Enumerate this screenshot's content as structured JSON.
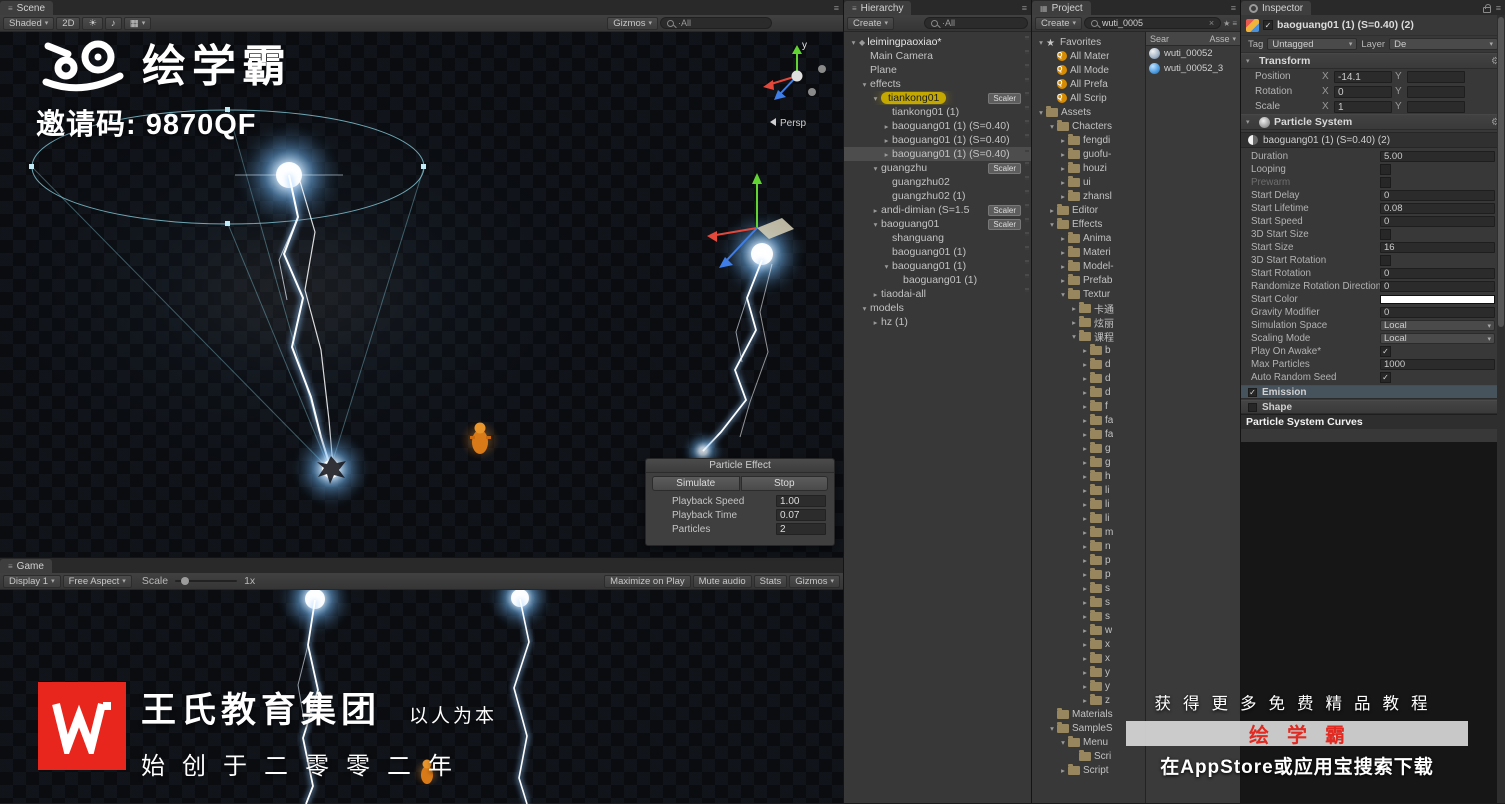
{
  "icons": {
    "caret": "▾",
    "collapsed": "▸",
    "menu": "≡",
    "grid": "▦",
    "sun": "☀",
    "audio": "♪",
    "gear": "⚙",
    "clear": "×",
    "star": "★",
    "check": "✓"
  },
  "colors": {
    "brand_red": "#e02a22",
    "ping_yellow": "#c2a800",
    "lightning_glow": "#7ec8ff",
    "selection_gray": "#4d4d4d",
    "panel_bg": "#383838"
  },
  "scene": {
    "tab": "Scene",
    "toolbar": {
      "shaded": "Shaded",
      "mode_2d": "2D",
      "gizmos": "Gizmos",
      "search": "·All"
    },
    "axis_y": "y",
    "persp": "Persp",
    "particle_effect": {
      "title": "Particle Effect",
      "simulate": "Simulate",
      "stop": "Stop",
      "rows": [
        {
          "label": "Playback Speed",
          "value": "1.00"
        },
        {
          "label": "Playback Time",
          "value": "0.07"
        },
        {
          "label": "Particles",
          "value": "2"
        }
      ]
    }
  },
  "game": {
    "tab": "Game",
    "toolbar": {
      "display": "Display 1",
      "aspect": "Free Aspect",
      "scale_label": "Scale",
      "scale_value": "1x",
      "maximize": "Maximize on Play",
      "mute": "Mute audio",
      "stats": "Stats",
      "gizmos": "Gizmos"
    }
  },
  "hierarchy": {
    "tab": "Hierarchy",
    "create": "Create",
    "search": "·All",
    "items": [
      {
        "label": "leimingpaoxiao*",
        "arrow": "▾",
        "indent": 0,
        "cls": "scene-root"
      },
      {
        "label": "Main Camera",
        "indent": 1
      },
      {
        "label": "Plane",
        "indent": 1
      },
      {
        "label": "effects",
        "arrow": "▾",
        "indent": 1
      },
      {
        "label": "tiankong01",
        "arrow": "▾",
        "indent": 2,
        "badge": "Scaler",
        "cls": "ping"
      },
      {
        "label": "tiankong01 (1)",
        "indent": 3
      },
      {
        "label": "baoguang01 (1) (S=0.40)",
        "arrow": "▸",
        "indent": 3
      },
      {
        "label": "baoguang01 (1) (S=0.40)",
        "arrow": "▸",
        "indent": 3
      },
      {
        "label": "baoguang01 (1) (S=0.40)",
        "arrow": "▸",
        "indent": 3,
        "cls": "selected"
      },
      {
        "label": "guangzhu",
        "arrow": "▾",
        "indent": 2,
        "badge": "Scaler"
      },
      {
        "label": "guangzhu02",
        "indent": 3
      },
      {
        "label": "guangzhu02 (1)",
        "indent": 3
      },
      {
        "label": "andi-dimian (S=1.5",
        "arrow": "▸",
        "indent": 2,
        "badge": "Scaler"
      },
      {
        "label": "baoguang01",
        "arrow": "▾",
        "indent": 2,
        "badge": "Scaler"
      },
      {
        "label": "shanguang",
        "indent": 3
      },
      {
        "label": "baoguang01 (1)",
        "indent": 3
      },
      {
        "label": "baoguang01 (1)",
        "arrow": "▾",
        "indent": 3
      },
      {
        "label": "baoguang01 (1)",
        "indent": 4
      },
      {
        "label": "tiaodai-all",
        "arrow": "▸",
        "indent": 2
      },
      {
        "label": "models",
        "arrow": "▾",
        "indent": 1
      },
      {
        "label": "hz (1)",
        "arrow": "▸",
        "indent": 2
      }
    ]
  },
  "project": {
    "tab": "Project",
    "create": "Create",
    "search_value": "wuti_0005",
    "results_header_left": "Sear",
    "results_header_right": "Asse",
    "results": [
      {
        "label": "wuti_00052",
        "icon": "mesh"
      },
      {
        "label": "wuti_00052_3",
        "icon": "prefab"
      }
    ],
    "tree": [
      {
        "label": "Favorites",
        "arrow": "▾",
        "icon": "star",
        "indent": 0
      },
      {
        "label": "All Mater",
        "icon": "q",
        "indent": 1
      },
      {
        "label": "All Mode",
        "icon": "q",
        "indent": 1
      },
      {
        "label": "All Prefa",
        "icon": "q",
        "indent": 1
      },
      {
        "label": "All Scrip",
        "icon": "q",
        "indent": 1
      },
      {
        "label": "Assets",
        "arrow": "▾",
        "icon": "folder",
        "indent": 0
      },
      {
        "label": "Chacters",
        "arrow": "▾",
        "icon": "folder",
        "indent": 1
      },
      {
        "label": "fengdi",
        "arrow": "▸",
        "icon": "folder",
        "indent": 2
      },
      {
        "label": "guofu-",
        "arrow": "▸",
        "icon": "folder",
        "indent": 2
      },
      {
        "label": "houzi",
        "arrow": "▸",
        "icon": "folder",
        "indent": 2
      },
      {
        "label": "ui",
        "arrow": "▸",
        "icon": "folder",
        "indent": 2
      },
      {
        "label": "zhansl",
        "arrow": "▸",
        "icon": "folder",
        "indent": 2
      },
      {
        "label": "Editor",
        "arrow": "▸",
        "icon": "folder",
        "indent": 1
      },
      {
        "label": "Effects",
        "arrow": "▾",
        "icon": "folder",
        "indent": 1
      },
      {
        "label": "Anima",
        "arrow": "▸",
        "icon": "folder",
        "indent": 2
      },
      {
        "label": "Materi",
        "arrow": "▸",
        "icon": "folder",
        "indent": 2
      },
      {
        "label": "Model-",
        "arrow": "▸",
        "icon": "folder",
        "indent": 2
      },
      {
        "label": "Prefab",
        "arrow": "▸",
        "icon": "folder",
        "indent": 2
      },
      {
        "label": "Textur",
        "arrow": "▾",
        "icon": "folder",
        "indent": 2
      },
      {
        "label": "卡通",
        "arrow": "▸",
        "icon": "folder",
        "indent": 3
      },
      {
        "label": "炫丽",
        "arrow": "▸",
        "icon": "folder",
        "indent": 3
      },
      {
        "label": "课程",
        "arrow": "▾",
        "icon": "folder",
        "indent": 3
      },
      {
        "label": "b",
        "arrow": "▸",
        "icon": "folder",
        "indent": 4
      },
      {
        "label": "d",
        "arrow": "▸",
        "icon": "folder",
        "indent": 4
      },
      {
        "label": "d",
        "arrow": "▸",
        "icon": "folder",
        "indent": 4
      },
      {
        "label": "d",
        "arrow": "▸",
        "icon": "folder",
        "indent": 4
      },
      {
        "label": "f",
        "arrow": "▸",
        "icon": "folder",
        "indent": 4
      },
      {
        "label": "fa",
        "arrow": "▸",
        "icon": "folder",
        "indent": 4
      },
      {
        "label": "fa",
        "arrow": "▸",
        "icon": "folder",
        "indent": 4
      },
      {
        "label": "g",
        "arrow": "▸",
        "icon": "folder",
        "indent": 4
      },
      {
        "label": "g",
        "arrow": "▸",
        "icon": "folder",
        "indent": 4
      },
      {
        "label": "h",
        "arrow": "▸",
        "icon": "folder",
        "indent": 4
      },
      {
        "label": "li",
        "arrow": "▸",
        "icon": "folder",
        "indent": 4
      },
      {
        "label": "li",
        "arrow": "▸",
        "icon": "folder",
        "indent": 4
      },
      {
        "label": "li",
        "arrow": "▸",
        "icon": "folder",
        "indent": 4
      },
      {
        "label": "m",
        "arrow": "▸",
        "icon": "folder",
        "indent": 4
      },
      {
        "label": "n",
        "arrow": "▸",
        "icon": "folder",
        "indent": 4
      },
      {
        "label": "p",
        "arrow": "▸",
        "icon": "folder",
        "indent": 4
      },
      {
        "label": "p",
        "arrow": "▸",
        "icon": "folder",
        "indent": 4
      },
      {
        "label": "s",
        "arrow": "▸",
        "icon": "folder",
        "indent": 4
      },
      {
        "label": "s",
        "arrow": "▸",
        "icon": "folder",
        "indent": 4
      },
      {
        "label": "s",
        "arrow": "▸",
        "icon": "folder",
        "indent": 4
      },
      {
        "label": "w",
        "arrow": "▸",
        "icon": "folder",
        "indent": 4
      },
      {
        "label": "x",
        "arrow": "▸",
        "icon": "folder",
        "indent": 4
      },
      {
        "label": "x",
        "arrow": "▸",
        "icon": "folder",
        "indent": 4
      },
      {
        "label": "y",
        "arrow": "▸",
        "icon": "folder",
        "indent": 4
      },
      {
        "label": "y",
        "arrow": "▸",
        "icon": "folder",
        "indent": 4
      },
      {
        "label": "z",
        "arrow": "▸",
        "icon": "folder",
        "indent": 4
      },
      {
        "label": "Materials",
        "icon": "folder",
        "indent": 1
      },
      {
        "label": "SampleS",
        "arrow": "▾",
        "icon": "folder",
        "indent": 1
      },
      {
        "label": "Menu",
        "arrow": "▾",
        "icon": "folder",
        "indent": 2
      },
      {
        "label": "Scri",
        "icon": "folder",
        "indent": 3
      },
      {
        "label": "Script",
        "arrow": "▸",
        "icon": "folder",
        "indent": 2
      }
    ]
  },
  "inspector": {
    "tab": "Inspector",
    "object_name": "baoguang01 (1) (S=0.40) (2)",
    "tag_label": "Tag",
    "tag_value": "Untagged",
    "layer_label": "Layer",
    "layer_value": "De",
    "transform": {
      "title": "Transform",
      "rows": [
        {
          "label": "Position",
          "x_label": "X",
          "x": "-14.1",
          "y_label": "Y"
        },
        {
          "label": "Rotation",
          "x_label": "X",
          "x": "0",
          "y_label": "Y"
        },
        {
          "label": "Scale",
          "x_label": "X",
          "x": "1",
          "y_label": "Y"
        }
      ]
    },
    "particle_system": {
      "title": "Particle System",
      "instance_name": "baoguang01 (1) (S=0.40) (2)",
      "rows": [
        {
          "label": "Duration",
          "value": "5.00",
          "type": "field"
        },
        {
          "label": "Looping",
          "type": "check-off"
        },
        {
          "label": "Prewarm",
          "type": "check-off",
          "cls": "dim"
        },
        {
          "label": "Start Delay",
          "value": "0",
          "type": "field"
        },
        {
          "label": "Start Lifetime",
          "value": "0.08",
          "type": "field"
        },
        {
          "label": "Start Speed",
          "value": "0",
          "type": "field"
        },
        {
          "label": "3D Start Size",
          "type": "check-off"
        },
        {
          "label": "Start Size",
          "value": "16",
          "type": "field"
        },
        {
          "label": "3D Start Rotation",
          "type": "check-off"
        },
        {
          "label": "Start Rotation",
          "value": "0",
          "type": "field"
        },
        {
          "label": "Randomize Rotation Direction",
          "value": "0",
          "type": "field"
        },
        {
          "label": "Start Color",
          "type": "swatch"
        },
        {
          "label": "Gravity Modifier",
          "value": "0",
          "type": "field"
        },
        {
          "label": "Simulation Space",
          "value": "Local",
          "type": "dropdown"
        },
        {
          "label": "Scaling Mode",
          "value": "Local",
          "type": "dropdown"
        },
        {
          "label": "Play On Awake*",
          "type": "check-on"
        },
        {
          "label": "Max Particles",
          "value": "1000",
          "type": "field"
        },
        {
          "label": "Auto Random Seed",
          "type": "check-on"
        }
      ],
      "modules": [
        {
          "label": "Emission",
          "cls": "checked sel"
        },
        {
          "label": "Shape"
        }
      ],
      "curves_title": "Particle System Curves"
    }
  },
  "watermarks": {
    "brand_text": "绘学霸",
    "invite_code": "邀请码: 9870QF",
    "wang_title": "王氏教育集团",
    "wang_slogan": "以人为本",
    "wang_subtitle": "始创于二零零二年",
    "promo_line1": "获得更多免费精品教程",
    "promo_brand": "绘学霸",
    "promo_line2": "在AppStore或应用宝搜索下载"
  }
}
